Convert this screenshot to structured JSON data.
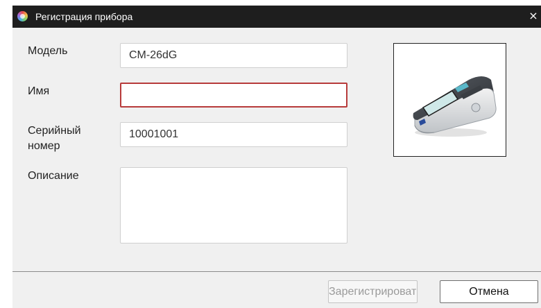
{
  "window": {
    "title": "Регистрация прибора",
    "close_glyph": "×",
    "app_icon": "color-wheel-icon"
  },
  "form": {
    "model": {
      "label": "Модель",
      "value": "CM-26dG"
    },
    "name": {
      "label": "Имя",
      "value": ""
    },
    "serial": {
      "label_line1": "Серийный",
      "label_line2": "номер",
      "value": "10001001"
    },
    "description": {
      "label": "Описание",
      "value": ""
    }
  },
  "device_image": {
    "icon": "spectrophotometer-device-image"
  },
  "buttons": {
    "register_label": "Зарегистрировать",
    "cancel_label": "Отмена"
  },
  "colors": {
    "titlebar": "#1e1e1e",
    "dialog_bg": "#f0f0f0",
    "focus_border": "#b73a3a"
  }
}
